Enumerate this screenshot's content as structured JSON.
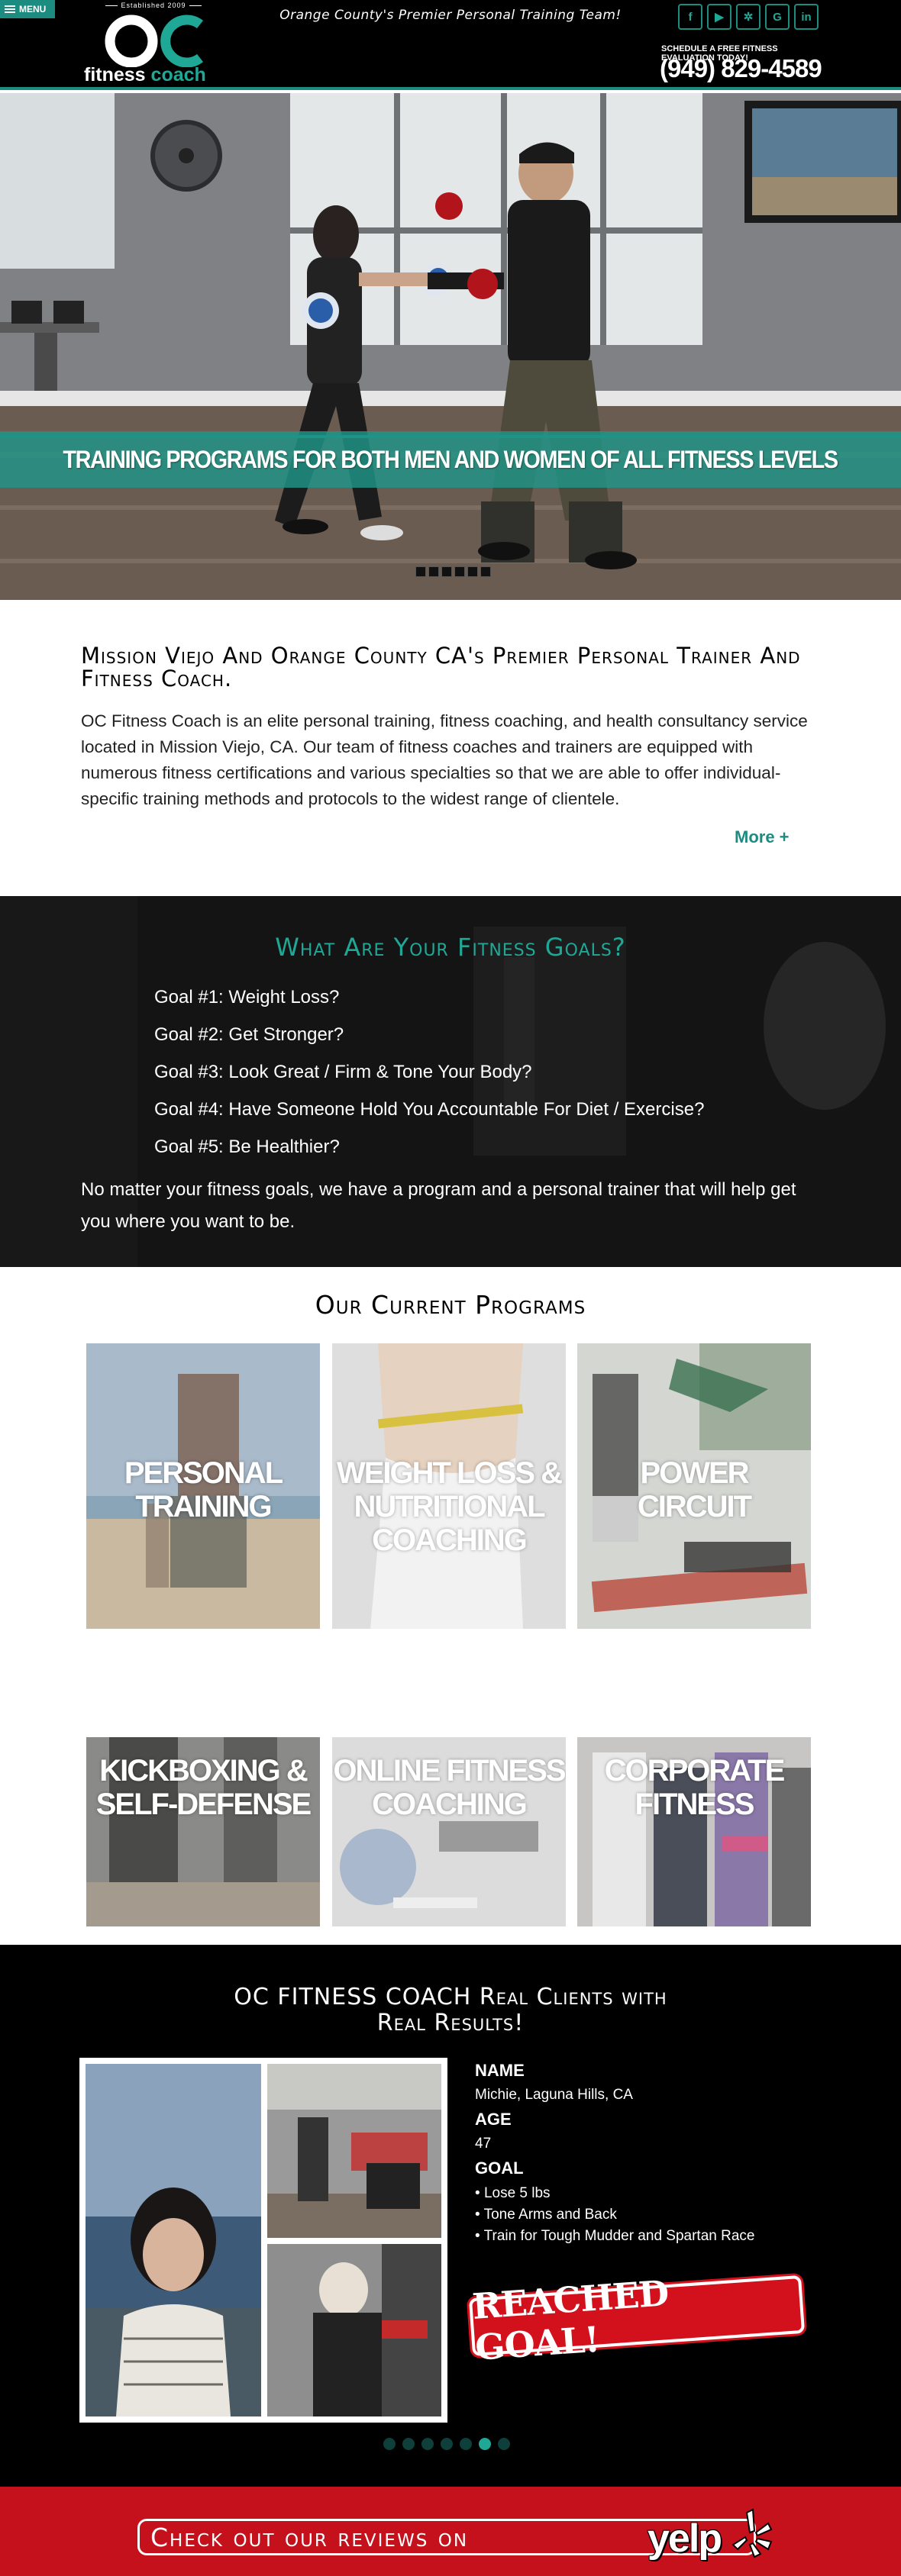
{
  "header": {
    "menu_label": "MENU",
    "logo_established": "Established 2009",
    "logo_word1": "fitness",
    "logo_word2": " coach",
    "tagline": "Orange County's Premier Personal Training Team!",
    "socials": [
      {
        "name": "facebook-icon",
        "glyph": "f"
      },
      {
        "name": "youtube-icon",
        "glyph": "▶"
      },
      {
        "name": "yelp-small-icon",
        "glyph": "✲"
      },
      {
        "name": "google-plus-icon",
        "glyph": "G"
      },
      {
        "name": "linkedin-icon",
        "glyph": "in"
      }
    ],
    "schedule_text": "SCHEDULE A FREE FITNESS EVALUATION TODAY!",
    "phone": "(949) 829-4589"
  },
  "hero": {
    "banner": "TRAINING PROGRAMS FOR BOTH MEN AND WOMEN OF ALL FITNESS LEVELS",
    "slide_count": 6
  },
  "intro": {
    "heading": "Mission Viejo And Orange County CA's Premier Personal Trainer And Fitness Coach.",
    "body": "OC Fitness Coach is an elite personal training, fitness coaching, and health consultancy service located in Mission Viejo, CA. Our team of fitness coaches and trainers are equipped with numerous fitness certifications and various specialties so that we are able to offer individual-specific training methods and protocols to the widest range of clientele.",
    "more_link": "More +"
  },
  "goals": {
    "heading": "What Are Your Fitness Goals?",
    "items": [
      "Goal #1: Weight Loss?",
      "Goal #2: Get Stronger?",
      "Goal #3: Look Great / Firm & Tone Your Body?",
      "Goal #4: Have Someone Hold You Accountable For Diet / Exercise?",
      "Goal #5: Be Healthier?"
    ],
    "closing": "No matter your fitness goals, we have a program and a personal trainer that will help get you where you want to be."
  },
  "programs": {
    "heading": "Our Current Programs",
    "tiles": [
      {
        "label": "PERSONAL\nTRAINING"
      },
      {
        "label": "WEIGHT LOSS &\nNUTRITIONAL\nCOACHING"
      },
      {
        "label": "POWER\nCIRCUIT"
      },
      {
        "label": "KICKBOXING &\nSELF-DEFENSE"
      },
      {
        "label": "ONLINE FITNESS\nCOACHING"
      },
      {
        "label": "CORPORATE\nFITNESS"
      }
    ]
  },
  "results": {
    "heading_line1": "OC FITNESS COACH Real Clients with",
    "heading_line2": "Real Results!",
    "name_label": "NAME",
    "name_value": "Michie, Laguna Hills, CA",
    "age_label": "AGE",
    "age_value": "47",
    "goal_label": "GOAL",
    "goals": [
      "Lose 5 lbs",
      "Tone Arms and Back",
      "Train for Tough Mudder and Spartan Race"
    ],
    "stamp": "REACHED GOAL!",
    "slide_count": 7,
    "active_slide": 6
  },
  "yelp": {
    "cta": "Check out our reviews on",
    "logo_word": "yelp"
  },
  "colors": {
    "accent": "#1c8c80",
    "accent_light": "#1fa896",
    "header_bg": "#000000",
    "yelp_red": "#c4111b"
  }
}
